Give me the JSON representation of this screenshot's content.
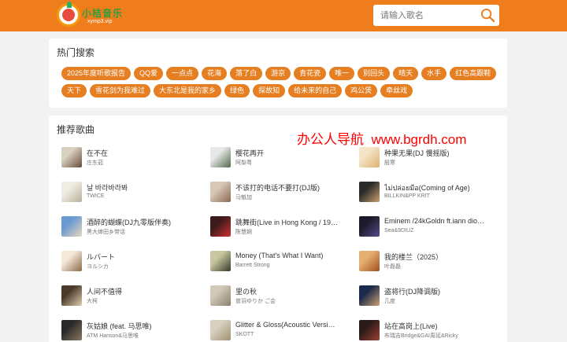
{
  "header": {
    "logo_text": "小桔音乐",
    "logo_sub": "xymp3.vip",
    "search_placeholder": "请输入歌名",
    "search_icon": "search-icon"
  },
  "hot": {
    "title": "热门搜索",
    "tags": [
      "2025年度听歌报告",
      "QQ爱",
      "一点点",
      "花海",
      "落了白",
      "游京",
      "青花瓷",
      "唯一",
      "别回头",
      "晴天",
      "水手",
      "红色高跟鞋",
      "天下",
      "雪花剑为我难过",
      "大东北是我的家乡",
      "绿色",
      "探故知",
      "给未来的自己",
      "鸡公煲",
      "牵丝戏"
    ]
  },
  "recommend": {
    "title": "推荐歌曲",
    "watermark_cn": "办公人导航",
    "watermark_url": "www.bgrdh.com",
    "songs": [
      {
        "title": "在不在",
        "artist": "庄东茹",
        "cover": [
          "#d8d0c0",
          "#6a4a3a"
        ]
      },
      {
        "title": "樱花再开",
        "artist": "阿梨粤",
        "cover": [
          "#e8e8e8",
          "#556b4f"
        ]
      },
      {
        "title": "种果无果(DJ 慢摇版)",
        "artist": "殷寒",
        "cover": [
          "#f4e4c8",
          "#e0b070"
        ]
      },
      {
        "title": "날 바라바라봐",
        "artist": "TWICE",
        "cover": [
          "#f0ede4",
          "#b8b098"
        ]
      },
      {
        "title": "不该打的电话不要打(DJ版)",
        "artist": "马魁加",
        "cover": [
          "#d8c8b8",
          "#8a6a50"
        ]
      },
      {
        "title": "ไม่ปล่อยมือ(Coming of Age)",
        "artist": "BILLKIN&PP KRIT",
        "cover": [
          "#2a2a2a",
          "#c8a070"
        ]
      },
      {
        "title": "酒醉的蝴蝶(DJ九零版伴奏)",
        "artist": "黑大婶田乡带话",
        "cover": [
          "#6a9ad0",
          "#e8d8c0"
        ]
      },
      {
        "title": "跳舞街(Live in Hong Kong / 19…",
        "artist": "陈慧娴",
        "cover": [
          "#3a1a1a",
          "#d03030"
        ]
      },
      {
        "title": "Eminem /24kGoldn ft.iann dio…",
        "artist": "Sea&9DIUZ",
        "cover": [
          "#1a1a2a",
          "#5a4a8a"
        ]
      },
      {
        "title": "ルバート",
        "artist": "ヨルシカ",
        "cover": [
          "#f4e8d8",
          "#8a6a4a"
        ]
      },
      {
        "title": "Money (That's What I Want)",
        "artist": "Barrett Strong",
        "cover": [
          "#c8c8a0",
          "#3a3a2a"
        ]
      },
      {
        "title": "我的楼兰（2025）",
        "artist": "叶磊磊",
        "cover": [
          "#e8b070",
          "#a05020"
        ]
      },
      {
        "title": "人间不值得",
        "artist": "大柯",
        "cover": [
          "#4a3a2a",
          "#e0d0b0"
        ]
      },
      {
        "title": "里の秋",
        "artist": "曽羽ゆりか ご会",
        "cover": [
          "#d0c8b8",
          "#8a8070"
        ]
      },
      {
        "title": "盗将行(DJ降调版)",
        "artist": "几度",
        "cover": [
          "#1a2a4a",
          "#d0a070"
        ]
      },
      {
        "title": "灰姑娘 (feat. 马思唯)",
        "artist": "ATM Hanson&马思唯",
        "cover": [
          "#2a2a2a",
          "#8a7a60"
        ]
      },
      {
        "title": "Glitter & Gloss(Acoustic Versi…",
        "artist": "SKOTT",
        "cover": [
          "#d8d0c0",
          "#a09070"
        ]
      },
      {
        "title": "站在高岗上(Live)",
        "artist": "布瑞吉Bridge&GAI周延&Ricky",
        "cover": [
          "#2a1a1a",
          "#a04030"
        ]
      }
    ]
  }
}
